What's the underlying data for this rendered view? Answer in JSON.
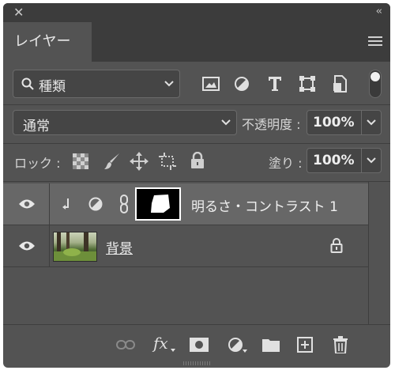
{
  "panel": {
    "tab_label": "レイヤー"
  },
  "filter": {
    "kind_label": "種類"
  },
  "blend": {
    "mode": "通常",
    "opacity_label": "不透明度 :",
    "opacity_value": "100%"
  },
  "lock": {
    "label": "ロック :",
    "fill_label": "塗り :",
    "fill_value": "100%"
  },
  "layers": [
    {
      "name": "明るさ・コントラスト 1",
      "selected": true
    },
    {
      "name": "背景",
      "selected": false
    }
  ],
  "footer": {
    "fx_label": "fx"
  },
  "colors": {
    "panel_bg": "#535353",
    "header_bg": "#3c3c3c",
    "selected_row": "#676767",
    "text": "#e6e6e6"
  }
}
